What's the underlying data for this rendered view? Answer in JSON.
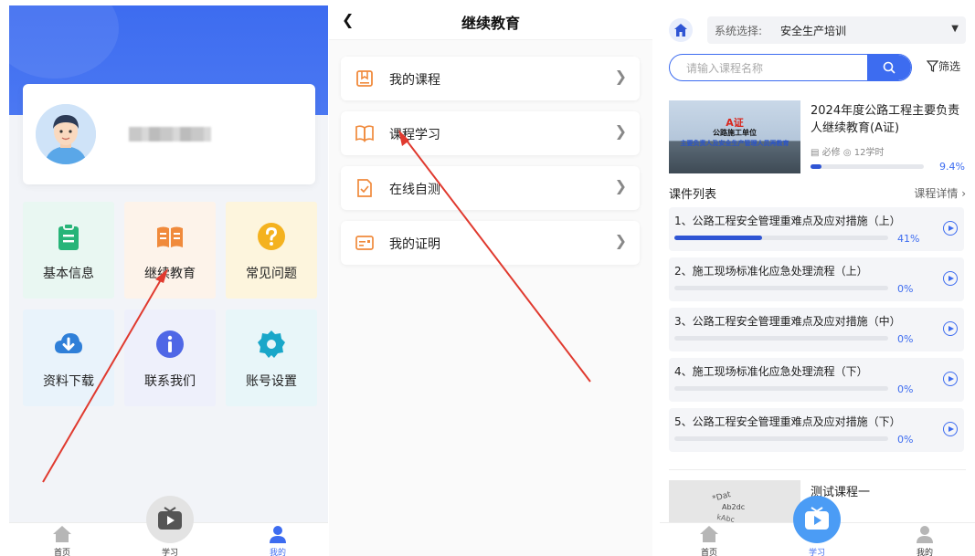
{
  "panel1": {
    "user_name": "",
    "tiles": [
      {
        "label": "基本信息",
        "icon": "clipboard-icon",
        "bg": "#e9f7f2",
        "color": "#27b478"
      },
      {
        "label": "继续教育",
        "icon": "open-book-icon",
        "bg": "#fdf3ea",
        "color": "#f08a3c"
      },
      {
        "label": "常见问题",
        "icon": "question-icon",
        "bg": "#fdf5dd",
        "color": "#f4b21f"
      },
      {
        "label": "资料下载",
        "icon": "cloud-download-icon",
        "bg": "#e9f3fb",
        "color": "#2f7fd8"
      },
      {
        "label": "联系我们",
        "icon": "info-icon",
        "bg": "#eef0fb",
        "color": "#4f67e6"
      },
      {
        "label": "账号设置",
        "icon": "gear-icon",
        "bg": "#e8f6f9",
        "color": "#19a7c9"
      }
    ],
    "tabbar": {
      "home": "首页",
      "study": "学习",
      "mine": "我的"
    }
  },
  "panel2": {
    "title": "继续教育",
    "rows": [
      {
        "label": "我的课程",
        "icon": "bookmark-icon"
      },
      {
        "label": "课程学习",
        "icon": "book-icon"
      },
      {
        "label": "在线自测",
        "icon": "checklist-icon"
      },
      {
        "label": "我的证明",
        "icon": "certificate-icon"
      }
    ],
    "accent": "#f08a3c"
  },
  "panel3": {
    "system_label": "系统选择:",
    "system_value": "安全生产培训",
    "search_placeholder": "请输入课程名称",
    "filter_label": "筛选",
    "course": {
      "thumb_line1": "A证",
      "thumb_line2": "公路施工单位",
      "thumb_line3": "主要负责人及安全生产管理人员再教育",
      "title": "2024年度公路工程主要负责人继续教育(A证)",
      "tag_required": "必修",
      "tag_hours": "12学时",
      "progress": 9.4,
      "progress_text": "9.4%"
    },
    "list_title": "课件列表",
    "list_detail": "课程详情",
    "lessons": [
      {
        "title": "1、公路工程安全管理重难点及应对措施（上）",
        "progress": 41,
        "progress_text": "41%"
      },
      {
        "title": "2、施工现场标准化应急处理流程（上）",
        "progress": 0,
        "progress_text": "0%"
      },
      {
        "title": "3、公路工程安全管理重难点及应对措施（中）",
        "progress": 0,
        "progress_text": "0%"
      },
      {
        "title": "4、施工现场标准化应急处理流程（下）",
        "progress": 0,
        "progress_text": "0%"
      },
      {
        "title": "5、公路工程安全管理重难点及应对措施（下）",
        "progress": 0,
        "progress_text": "0%"
      }
    ],
    "course2_title": "测试课程一",
    "tabbar": {
      "home": "首页",
      "study": "学习",
      "mine": "我的"
    },
    "accent": "#3d6cf0"
  }
}
